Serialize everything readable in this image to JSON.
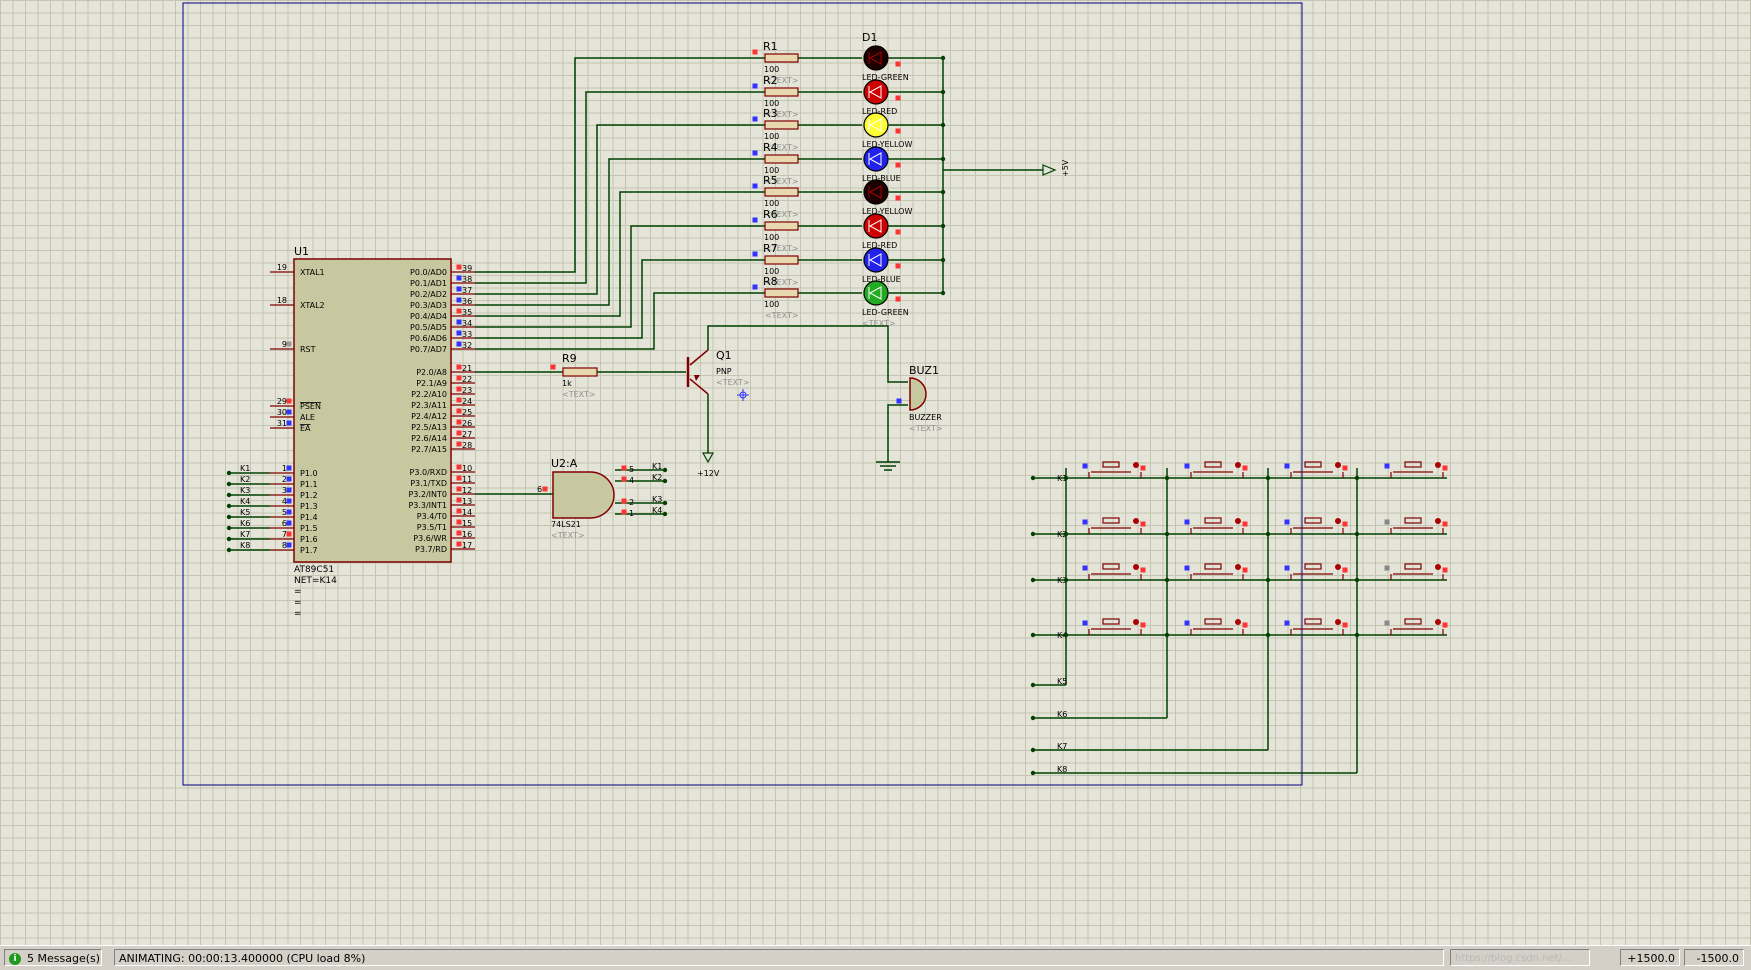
{
  "mcu": {
    "ref": "U1",
    "part": "AT89C51",
    "net": "NET=K14",
    "eq_lines": [
      "=",
      "=",
      "="
    ],
    "left_pins": [
      {
        "num": "19",
        "name": "XTAL1"
      },
      {
        "num": "18",
        "name": "XTAL2"
      },
      {
        "num": "9",
        "name": "RST"
      },
      {
        "num": "29",
        "name": "PSEN"
      },
      {
        "num": "30",
        "name": "ALE"
      },
      {
        "num": "31",
        "name": "EA"
      },
      {
        "num": "1",
        "name": "P1.0"
      },
      {
        "num": "2",
        "name": "P1.1"
      },
      {
        "num": "3",
        "name": "P1.2"
      },
      {
        "num": "4",
        "name": "P1.3"
      },
      {
        "num": "5",
        "name": "P1.4"
      },
      {
        "num": "6",
        "name": "P1.5"
      },
      {
        "num": "7",
        "name": "P1.6"
      },
      {
        "num": "8",
        "name": "P1.7"
      }
    ],
    "right_pins": [
      {
        "num": "39",
        "name": "P0.0/AD0"
      },
      {
        "num": "38",
        "name": "P0.1/AD1"
      },
      {
        "num": "37",
        "name": "P0.2/AD2"
      },
      {
        "num": "36",
        "name": "P0.3/AD3"
      },
      {
        "num": "35",
        "name": "P0.4/AD4"
      },
      {
        "num": "34",
        "name": "P0.5/AD5"
      },
      {
        "num": "33",
        "name": "P0.6/AD6"
      },
      {
        "num": "32",
        "name": "P0.7/AD7"
      },
      {
        "num": "21",
        "name": "P2.0/A8"
      },
      {
        "num": "22",
        "name": "P2.1/A9"
      },
      {
        "num": "23",
        "name": "P2.2/A10"
      },
      {
        "num": "24",
        "name": "P2.3/A11"
      },
      {
        "num": "25",
        "name": "P2.4/A12"
      },
      {
        "num": "26",
        "name": "P2.5/A13"
      },
      {
        "num": "27",
        "name": "P2.6/A14"
      },
      {
        "num": "28",
        "name": "P2.7/A15"
      },
      {
        "num": "10",
        "name": "P3.0/RXD"
      },
      {
        "num": "11",
        "name": "P3.1/TXD"
      },
      {
        "num": "12",
        "name": "P3.2/INT0"
      },
      {
        "num": "13",
        "name": "P3.3/INT1"
      },
      {
        "num": "14",
        "name": "P3.4/T0"
      },
      {
        "num": "15",
        "name": "P3.5/T1"
      },
      {
        "num": "16",
        "name": "P3.6/WR"
      },
      {
        "num": "17",
        "name": "P3.7/RD"
      }
    ],
    "p1_nets": [
      "K1",
      "K2",
      "K3",
      "K4",
      "K5",
      "K6",
      "K7",
      "K8"
    ]
  },
  "resistors": [
    {
      "ref": "R1",
      "value": "100",
      "text": "<TEXT>"
    },
    {
      "ref": "R2",
      "value": "100",
      "text": "<TEXT>"
    },
    {
      "ref": "R3",
      "value": "100",
      "text": "<TEXT>"
    },
    {
      "ref": "R4",
      "value": "100",
      "text": "<TEXT>"
    },
    {
      "ref": "R5",
      "value": "100",
      "text": "<TEXT>"
    },
    {
      "ref": "R6",
      "value": "100",
      "text": "<TEXT>"
    },
    {
      "ref": "R7",
      "value": "100",
      "text": "<TEXT>"
    },
    {
      "ref": "R8",
      "value": "100",
      "text": "<TEXT>"
    }
  ],
  "leds": [
    {
      "type": "LED-GREEN",
      "color": "#1a0000",
      "lit": false
    },
    {
      "type": "LED-RED",
      "color": "#cc0000",
      "lit": true
    },
    {
      "type": "LED-YELLOW",
      "color": "#ffff33",
      "lit": true
    },
    {
      "type": "LED-BLUE",
      "color": "#2222ee",
      "lit": true
    },
    {
      "type": "LED-YELLOW",
      "color": "#1a0000",
      "lit": false
    },
    {
      "type": "LED-RED",
      "color": "#cc0000",
      "lit": true
    },
    {
      "type": "LED-BLUE",
      "color": "#2222ee",
      "lit": true
    },
    {
      "type": "LED-GREEN",
      "color": "#22aa22",
      "lit": true
    }
  ],
  "d1_ref": "D1",
  "led_text": "<TEXT>",
  "power_5v": "+5V",
  "r9": {
    "ref": "R9",
    "value": "1k",
    "text": "<TEXT>"
  },
  "q1": {
    "ref": "Q1",
    "type": "PNP",
    "text": "<TEXT>",
    "supply": "+12V"
  },
  "buzzer": {
    "ref": "BUZ1",
    "type": "BUZZER",
    "text": "<TEXT>"
  },
  "gate": {
    "ref": "U2:A",
    "part": "74LS21",
    "text": "<TEXT>",
    "out_pin": "6",
    "inputs": [
      {
        "pin": "5",
        "net": "K1"
      },
      {
        "pin": "4",
        "net": "K2"
      },
      {
        "pin": "2",
        "net": "K3"
      },
      {
        "pin": "1",
        "net": "K4"
      }
    ]
  },
  "keypad": {
    "row_nets": [
      "K1",
      "K2",
      "K3",
      "K4"
    ],
    "col_nets": [
      "K5",
      "K6",
      "K7",
      "K8"
    ]
  },
  "colors": {
    "wire": "#004000",
    "component": "#800000",
    "body": "#c8c8a0",
    "border": "#000080",
    "pin_red": "#ff3333",
    "pin_blue": "#3333ff",
    "text_gray": "#909090"
  },
  "status": {
    "messages": "5 Message(s)",
    "animating": "ANIMATING: 00:00:13.400000 (CPU load 8%)",
    "watermark": "https://blog.csdn.net/...",
    "coord_x": "+1500.0",
    "coord_y": "-1500.0"
  }
}
